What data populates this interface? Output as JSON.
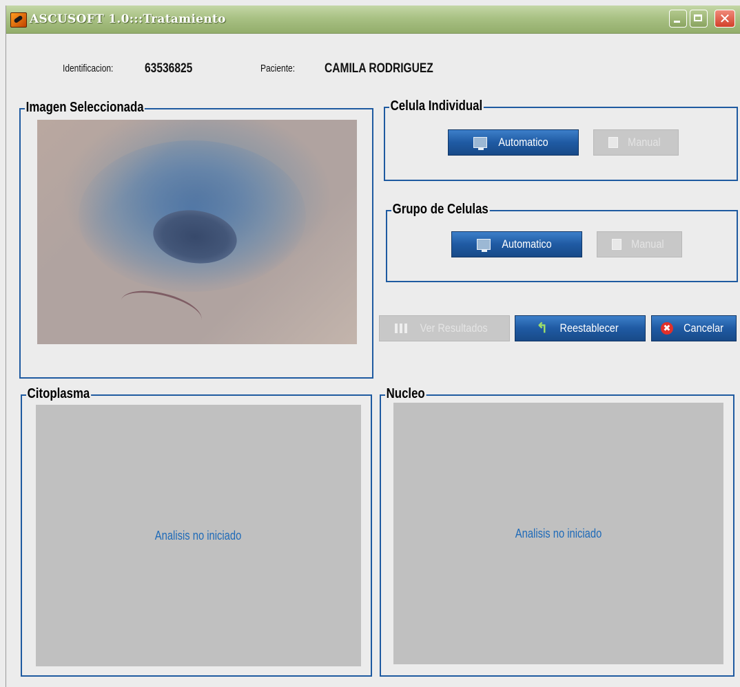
{
  "window": {
    "title": "ASCUSOFT 1.0:::Tratamiento",
    "close_glyph": "✕"
  },
  "patient": {
    "id_label": "Identificacion:",
    "id_value": "63536825",
    "name_label": "Paciente:",
    "name_value": "CAMILA RODRIGUEZ"
  },
  "image_panel": {
    "title": "Imagen Seleccionada"
  },
  "celula_individual": {
    "title": "Celula Individual",
    "auto_label": "Automatico",
    "manual_label": "Manual"
  },
  "grupo_celulas": {
    "title": "Grupo de Celulas",
    "auto_label": "Automatico",
    "manual_label": "Manual"
  },
  "actions": {
    "ver_resultados": "Ver Resultados",
    "reestablecer": "Reestablecer",
    "cancelar": "Cancelar",
    "undo_glyph": "↰",
    "cancel_glyph": "✖"
  },
  "citoplasma": {
    "title": "Citoplasma",
    "status": "Analisis no iniciado"
  },
  "nucleo": {
    "title": "Nucleo",
    "status": "Analisis no iniciado"
  },
  "colors": {
    "group_border": "#1e5aa0",
    "button_blue": "#1f5aa3",
    "status_text": "#1e6ab8",
    "titlebar": "#a9c184"
  },
  "icons": [
    "app-icon",
    "minimize-icon",
    "maximize-icon",
    "close-icon",
    "monitor-icon",
    "calculator-icon",
    "bar-chart-icon",
    "undo-icon",
    "cancel-icon"
  ]
}
